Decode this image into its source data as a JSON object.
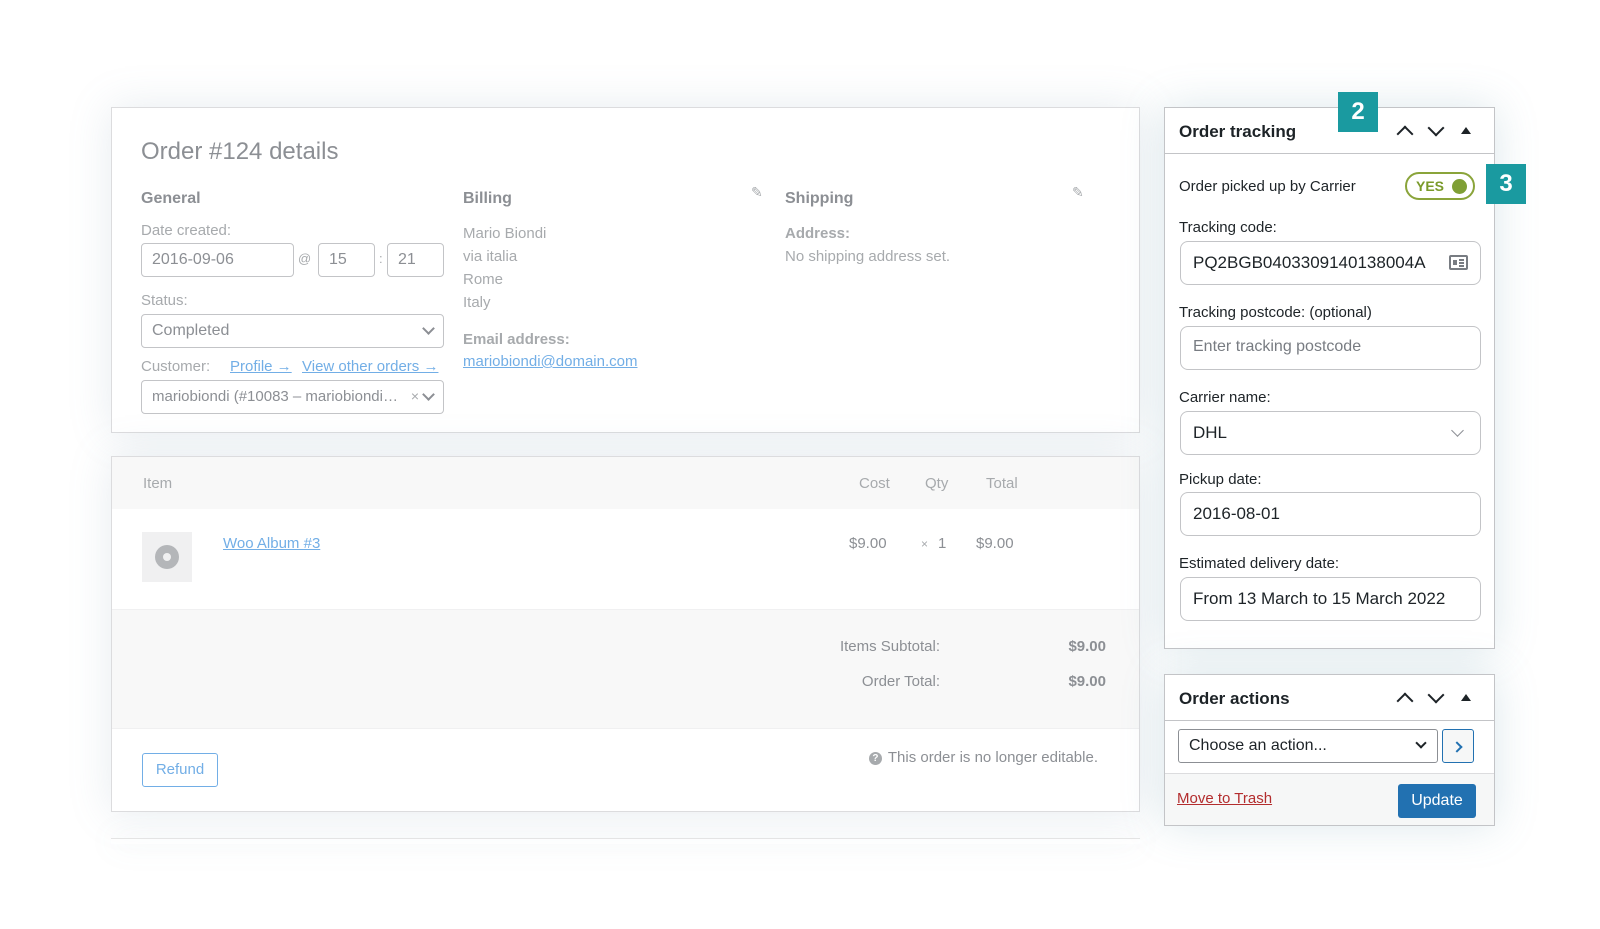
{
  "order": {
    "title": "Order #124 details",
    "general": {
      "heading": "General",
      "date_label": "Date created:",
      "date_value": "2016-09-06",
      "at_sign": "@",
      "hour": "15",
      "colon": ":",
      "minute": "21",
      "status_label": "Status:",
      "status_value": "Completed",
      "customer_label": "Customer:",
      "profile_link": "Profile →",
      "view_orders_link": "View other orders →",
      "customer_value": "mariobiondi (#10083 – mariobiondi…",
      "clear_symbol": "×"
    },
    "billing": {
      "heading": "Billing",
      "address_lines": [
        "Mario Biondi",
        "via italia",
        "Rome",
        "Italy"
      ],
      "email_label": "Email address:",
      "email_value": "mariobiondi@domain.com"
    },
    "shipping": {
      "heading": "Shipping",
      "address_label": "Address:",
      "address_value": "No shipping address set."
    }
  },
  "items": {
    "columns": {
      "item": "Item",
      "cost": "Cost",
      "qty": "Qty",
      "total": "Total"
    },
    "rows": [
      {
        "name": "Woo Album #3",
        "cost": "$9.00",
        "qty_prefix": "×",
        "qty": "1",
        "total": "$9.00"
      }
    ],
    "subtotal_label": "Items Subtotal:",
    "subtotal_value": "$9.00",
    "order_total_label": "Order Total:",
    "order_total_value": "$9.00",
    "refund_label": "Refund",
    "help_symbol": "?",
    "not_editable_note": "This order is no longer editable."
  },
  "tracking": {
    "title": "Order tracking",
    "badge_2": "2",
    "badge_3": "3",
    "picked_up_label": "Order picked up by Carrier",
    "toggle_label": "YES",
    "tracking_code_label": "Tracking code:",
    "tracking_code_value": "PQ2BGB0403309140138004A",
    "postcode_label": "Tracking postcode: (optional)",
    "postcode_placeholder": "Enter tracking postcode",
    "carrier_label": "Carrier name:",
    "carrier_value": "DHL",
    "pickup_label": "Pickup date:",
    "pickup_value": "2016-08-01",
    "delivery_label": "Estimated delivery date:",
    "delivery_value": "From 13 March to 15 March 2022"
  },
  "actions": {
    "title": "Order actions",
    "select_value": "Choose an action...",
    "trash_label": "Move to Trash",
    "update_label": "Update"
  },
  "colors": {
    "accent_blue": "#2271b1",
    "badge_teal": "#1a9aa0",
    "toggle_green": "#7f9f35",
    "trash_red": "#b32d2e"
  }
}
